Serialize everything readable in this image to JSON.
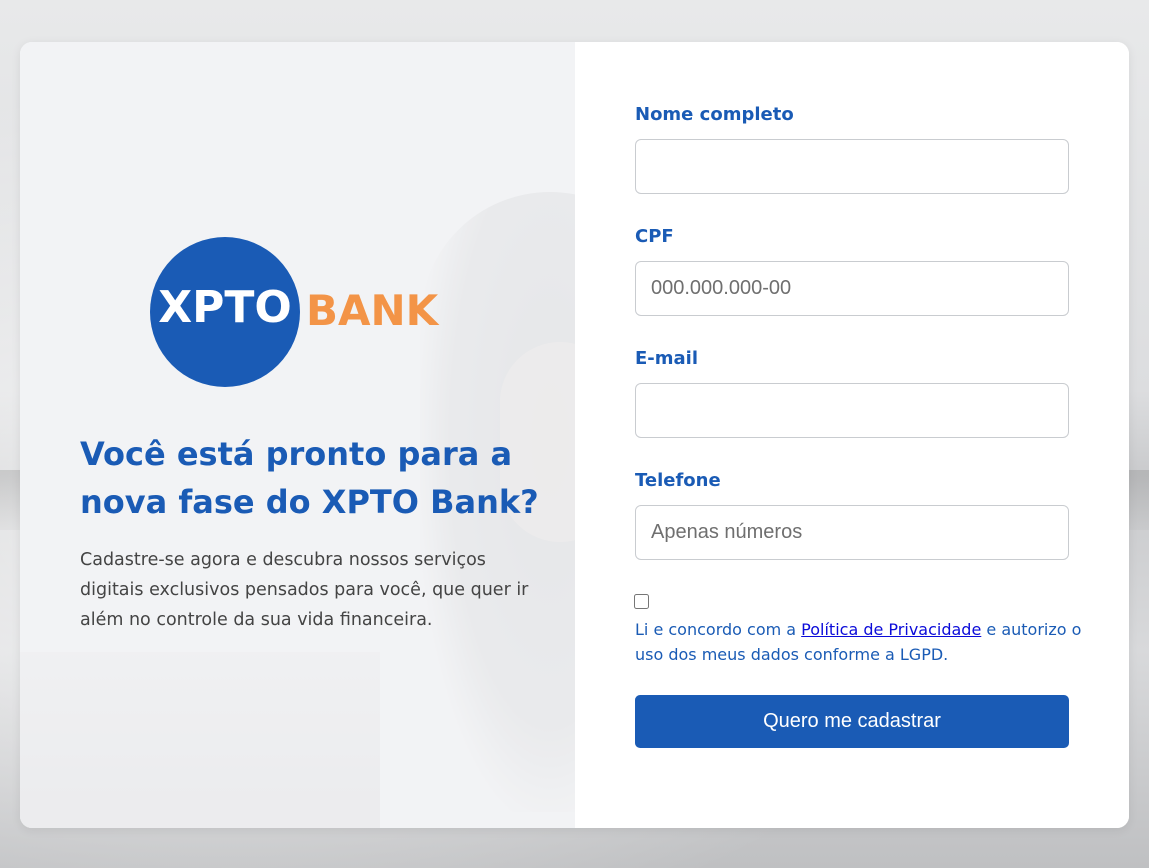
{
  "brand": {
    "logo_part1": "XPTO",
    "logo_part2": "BANK",
    "primary_color": "#1a5bb5",
    "accent_color": "#f39447"
  },
  "hero": {
    "headline": "Você está pronto para a nova fase do XPTO Bank?",
    "description": "Cadastre-se agora e descubra nossos serviços digitais exclusivos pensados para você, que quer ir além no controle da sua vida financeira."
  },
  "form": {
    "name": {
      "label": "Nome completo",
      "value": "",
      "placeholder": ""
    },
    "cpf": {
      "label": "CPF",
      "value": "",
      "placeholder": "000.000.000-00"
    },
    "email": {
      "label": "E-mail",
      "value": "",
      "placeholder": ""
    },
    "phone": {
      "label": "Telefone",
      "value": "",
      "placeholder": "Apenas números"
    },
    "consent": {
      "checked": false,
      "text_before": "Li e concordo com a ",
      "link_text": "Política de Privacidade",
      "text_after": " e autorizo o uso dos meus dados conforme a LGPD."
    },
    "submit_label": "Quero me cadastrar"
  }
}
